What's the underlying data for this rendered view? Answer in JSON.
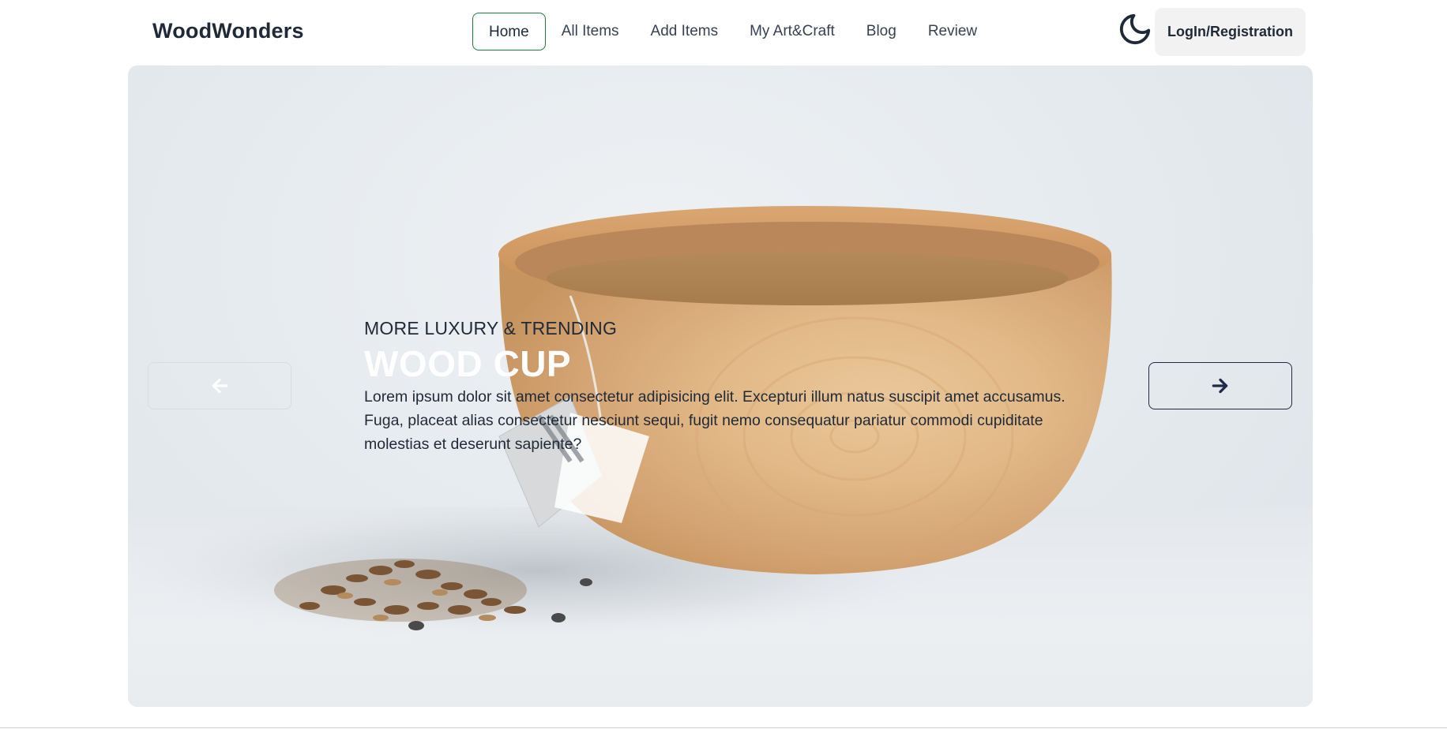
{
  "header": {
    "brand": "WoodWonders",
    "nav": [
      {
        "label": "Home",
        "active": true
      },
      {
        "label": "All Items",
        "active": false
      },
      {
        "label": "Add Items",
        "active": false
      },
      {
        "label": "My Art&Craft",
        "active": false
      },
      {
        "label": "Blog",
        "active": false
      },
      {
        "label": "Review",
        "active": false
      }
    ],
    "theme_toggle_icon": "moon-icon",
    "login_label": "LogIn/Registration"
  },
  "hero": {
    "eyebrow": "MORE LUXURY & TRENDING",
    "title": "WOOD CUP",
    "description": "Lorem ipsum dolor sit amet consectetur adipisicing elit. Excepturi illum natus suscipit amet accusamus. Fuga, placeat alias consectetur nesciunt sequi, fugit nemo consequatur pariatur commodi cupiditate molestias et deserunt sapiente?",
    "image_subject": "wooden bowl with tea bag and loose tea",
    "prev_icon": "arrow-left-icon",
    "next_icon": "arrow-right-icon"
  },
  "colors": {
    "accent_border": "#15803d",
    "dark_text": "#1f2937",
    "login_bg": "#f2f2f2",
    "next_arrow": "#1e2a48",
    "prev_arrow": "#ffffff"
  }
}
